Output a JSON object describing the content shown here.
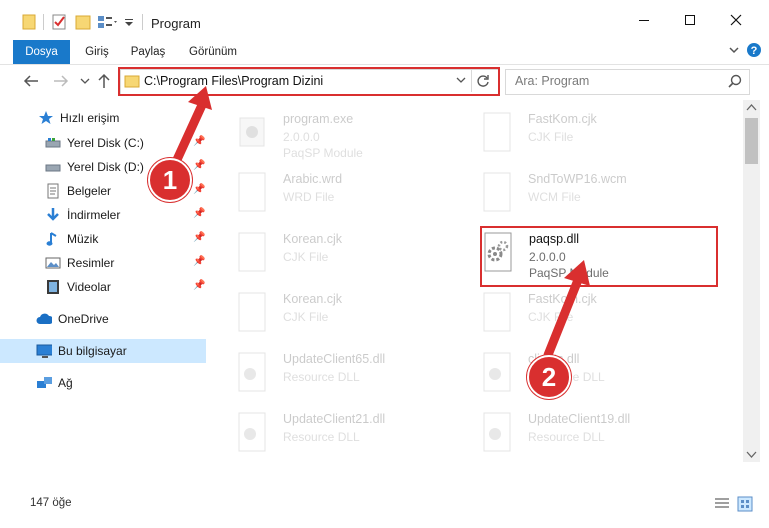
{
  "window": {
    "title": "Program"
  },
  "ribbon": {
    "tabs": [
      "Dosya",
      "Giriş",
      "Paylaş",
      "Görünüm"
    ]
  },
  "address": {
    "path": "C:\\Program Files\\Program Dizini"
  },
  "search": {
    "placeholder": "Ara: Program"
  },
  "sidebar": {
    "quick_access": "Hızlı erişim",
    "items": [
      {
        "label": "Yerel Disk (C:)",
        "icon": "drive-icon"
      },
      {
        "label": "Yerel Disk (D:)",
        "icon": "drive-icon"
      },
      {
        "label": "Belgeler",
        "icon": "documents-icon"
      },
      {
        "label": "İndirmeler",
        "icon": "download-icon"
      },
      {
        "label": "Müzik",
        "icon": "music-icon"
      },
      {
        "label": "Resimler",
        "icon": "pictures-icon"
      },
      {
        "label": "Videolar",
        "icon": "video-icon"
      }
    ],
    "onedrive": "OneDrive",
    "this_pc": "Bu bilgisayar",
    "network": "Ağ"
  },
  "files": [
    {
      "name": "program.exe",
      "type": "2.0.0.0",
      "sub": "PaqSP Module"
    },
    {
      "name": "FastKom.cjk",
      "type": "CJK File"
    },
    {
      "name": "Arabic.wrd",
      "type": "WRD File"
    },
    {
      "name": "SndToWP16.wcm",
      "type": "WCM File"
    },
    {
      "name": "Korean.cjk",
      "type": "CJK File"
    },
    {
      "name": "paqsp.dll",
      "type": "2.0.0.0",
      "sub": "PaqSP Module"
    },
    {
      "name": "Korean.cjk",
      "type": "CJK File"
    },
    {
      "name": "FastKom.cjk",
      "type": "CJK File"
    },
    {
      "name": "UpdateClient65.dll",
      "type": "Resource DLL"
    },
    {
      "name": "clients.dll",
      "type": "Resource DLL"
    },
    {
      "name": "UpdateClient21.dll",
      "type": "Resource DLL"
    },
    {
      "name": "UpdateClient19.dll",
      "type": "Resource DLL"
    }
  ],
  "status": {
    "count": "147 öğe"
  },
  "callouts": [
    "1",
    "2"
  ]
}
